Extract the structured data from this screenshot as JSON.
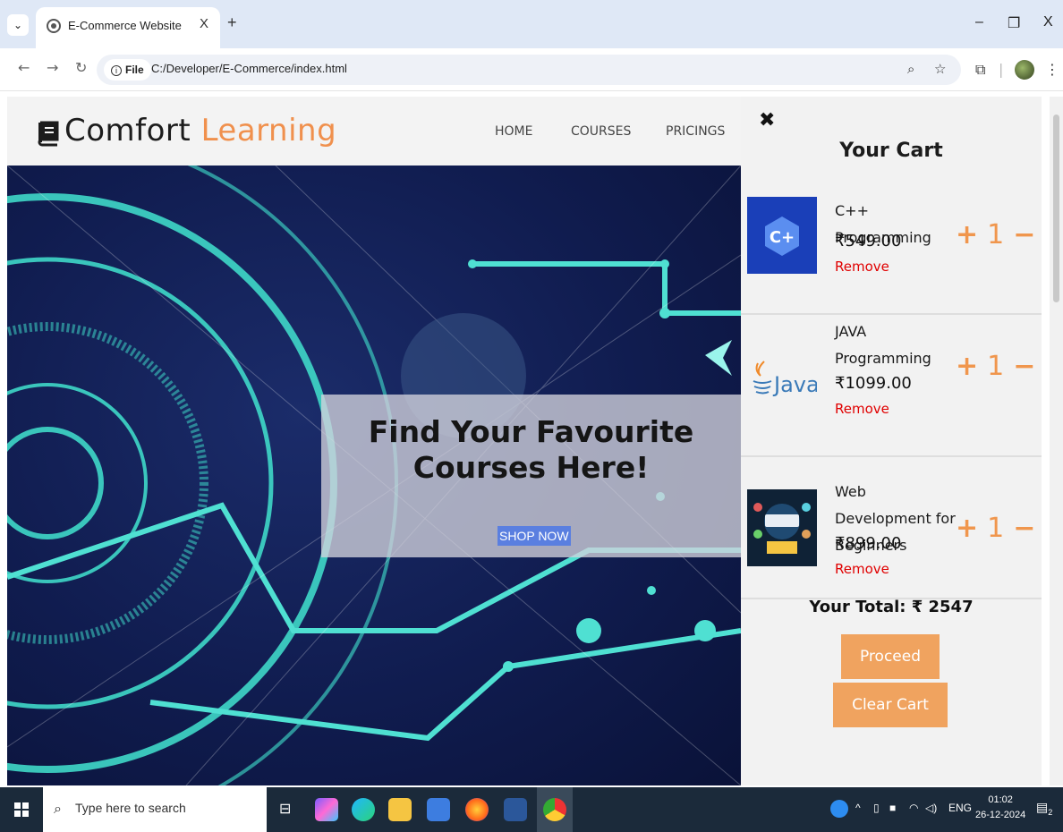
{
  "browser": {
    "tab_title": "E-Commerce Website",
    "tab_close": "X",
    "new_tab": "+",
    "site_info_label": "File",
    "url": "C:/Developer/E-Commerce/index.html",
    "window_controls": [
      "–",
      "❐",
      "X"
    ]
  },
  "site": {
    "logo_main": "Comfort",
    "logo_accent": "Learning",
    "nav": [
      "HOME",
      "COURSES",
      "PRICINGS"
    ]
  },
  "hero": {
    "title_line1": "Find Your Favourite",
    "title_line2": "Courses Here!",
    "shop_button": "SHOP NOW"
  },
  "cart": {
    "close_icon": "✖",
    "title": "Your Cart",
    "items": [
      {
        "name": "C++ Programming",
        "price": "₹549.00",
        "remove": "Remove",
        "qty": "1",
        "image": "cpp-logo"
      },
      {
        "name": "JAVA Programming",
        "price": "₹1099.00",
        "remove": "Remove",
        "qty": "1",
        "image": "java-logo"
      },
      {
        "name": "Web Development for Beginners",
        "price": "₹899.00",
        "remove": "Remove",
        "qty": "1",
        "image": "webdev-illustration"
      }
    ],
    "plus": "+",
    "minus": "−",
    "java_logo_text": "Java",
    "total": "Your Total: ₹ 2547",
    "proceed": "Proceed",
    "clear": "Clear Cart"
  },
  "taskbar": {
    "search_placeholder": "Type here to search",
    "lang": "ENG",
    "time": "01:02",
    "date": "26-12-2024",
    "notif_count": "2"
  },
  "colors": {
    "accent": "#f0964d",
    "remove": "#e00000",
    "hero_bg": "#101c4f",
    "teal": "#4fe0d2"
  }
}
